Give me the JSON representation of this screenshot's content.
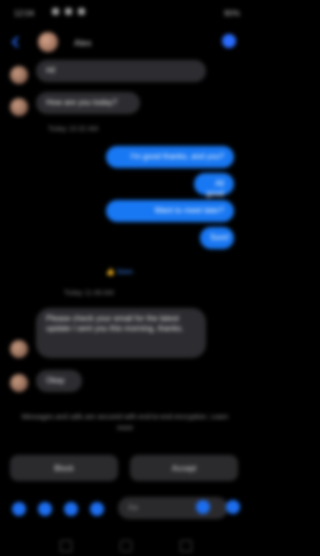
{
  "status": {
    "time": "12:04",
    "right": "90%"
  },
  "header": {
    "contact_name": "Alex"
  },
  "messages": {
    "in1": "Hi!",
    "in2": "How are you today?",
    "divider1": "Today 10:32 AM",
    "out1": "I'm good thanks, and you?",
    "out2": "All good",
    "out3": "Want to meet later?",
    "out4": "Sure!",
    "reaction": "👍 Seen",
    "divider2": "Today 11:48 AM",
    "in3": "Please check your email for the latest update I sent you this morning, thanks.",
    "in4": "Okay"
  },
  "notice": "Messages and calls are secured with end-to-end encryption. Learn more",
  "actions": {
    "left": "Block",
    "right": "Accept"
  },
  "composer": {
    "placeholder": "Aa"
  },
  "colors": {
    "accent": "#1877f2",
    "incoming": "#2d2d31",
    "background": "#000000"
  }
}
